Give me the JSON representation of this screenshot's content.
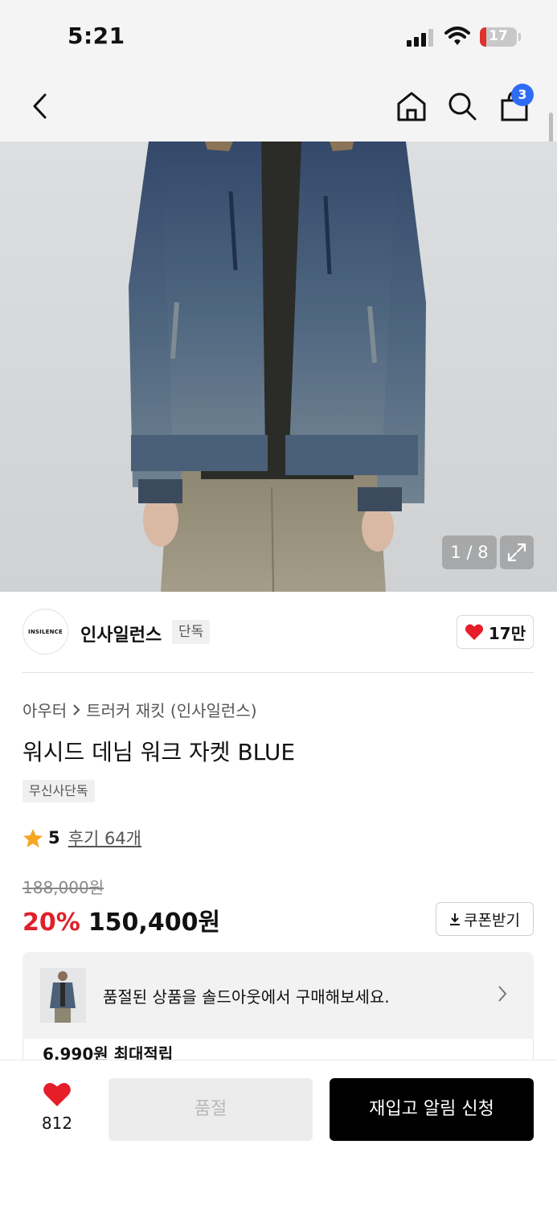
{
  "status_bar": {
    "time": "5:21",
    "battery": "17",
    "battery_level": 0.17
  },
  "nav": {
    "cart_badge": "3",
    "icons": [
      "back-arrow-icon",
      "home-icon",
      "search-icon",
      "cart-bag-icon"
    ]
  },
  "gallery": {
    "counter": "1 / 8"
  },
  "brand": {
    "logo_text": "INSILENCE",
    "name": "인사일런스",
    "tag": "단독",
    "likes": "17만"
  },
  "product": {
    "breadcrumb": [
      "아우터",
      "트러커 재킷 (인사일런스)"
    ],
    "title": "워시드 데님 워크 자켓 BLUE",
    "exclusive_tag": "무신사단독",
    "rating": {
      "score": "5",
      "reviews": "후기 64개",
      "stars": 5
    },
    "original_price": "188,000원",
    "discount": "20%",
    "price": "150,400원",
    "coupon_label": "쿠폰받기"
  },
  "banner": {
    "text": "품절된 상품을 솔드아웃에서 구매해보세요."
  },
  "points": {
    "text": "6,990원 최대적립"
  },
  "bottom_bar": {
    "wish_count": "812",
    "soldout_label": "품절",
    "restock_label": "재입고 알림 신청"
  },
  "colors": {
    "accent_blue": "#2f6cf5",
    "discount_red": "#e0202a",
    "heart_red": "#e51e2a",
    "star": "#f5a623"
  }
}
